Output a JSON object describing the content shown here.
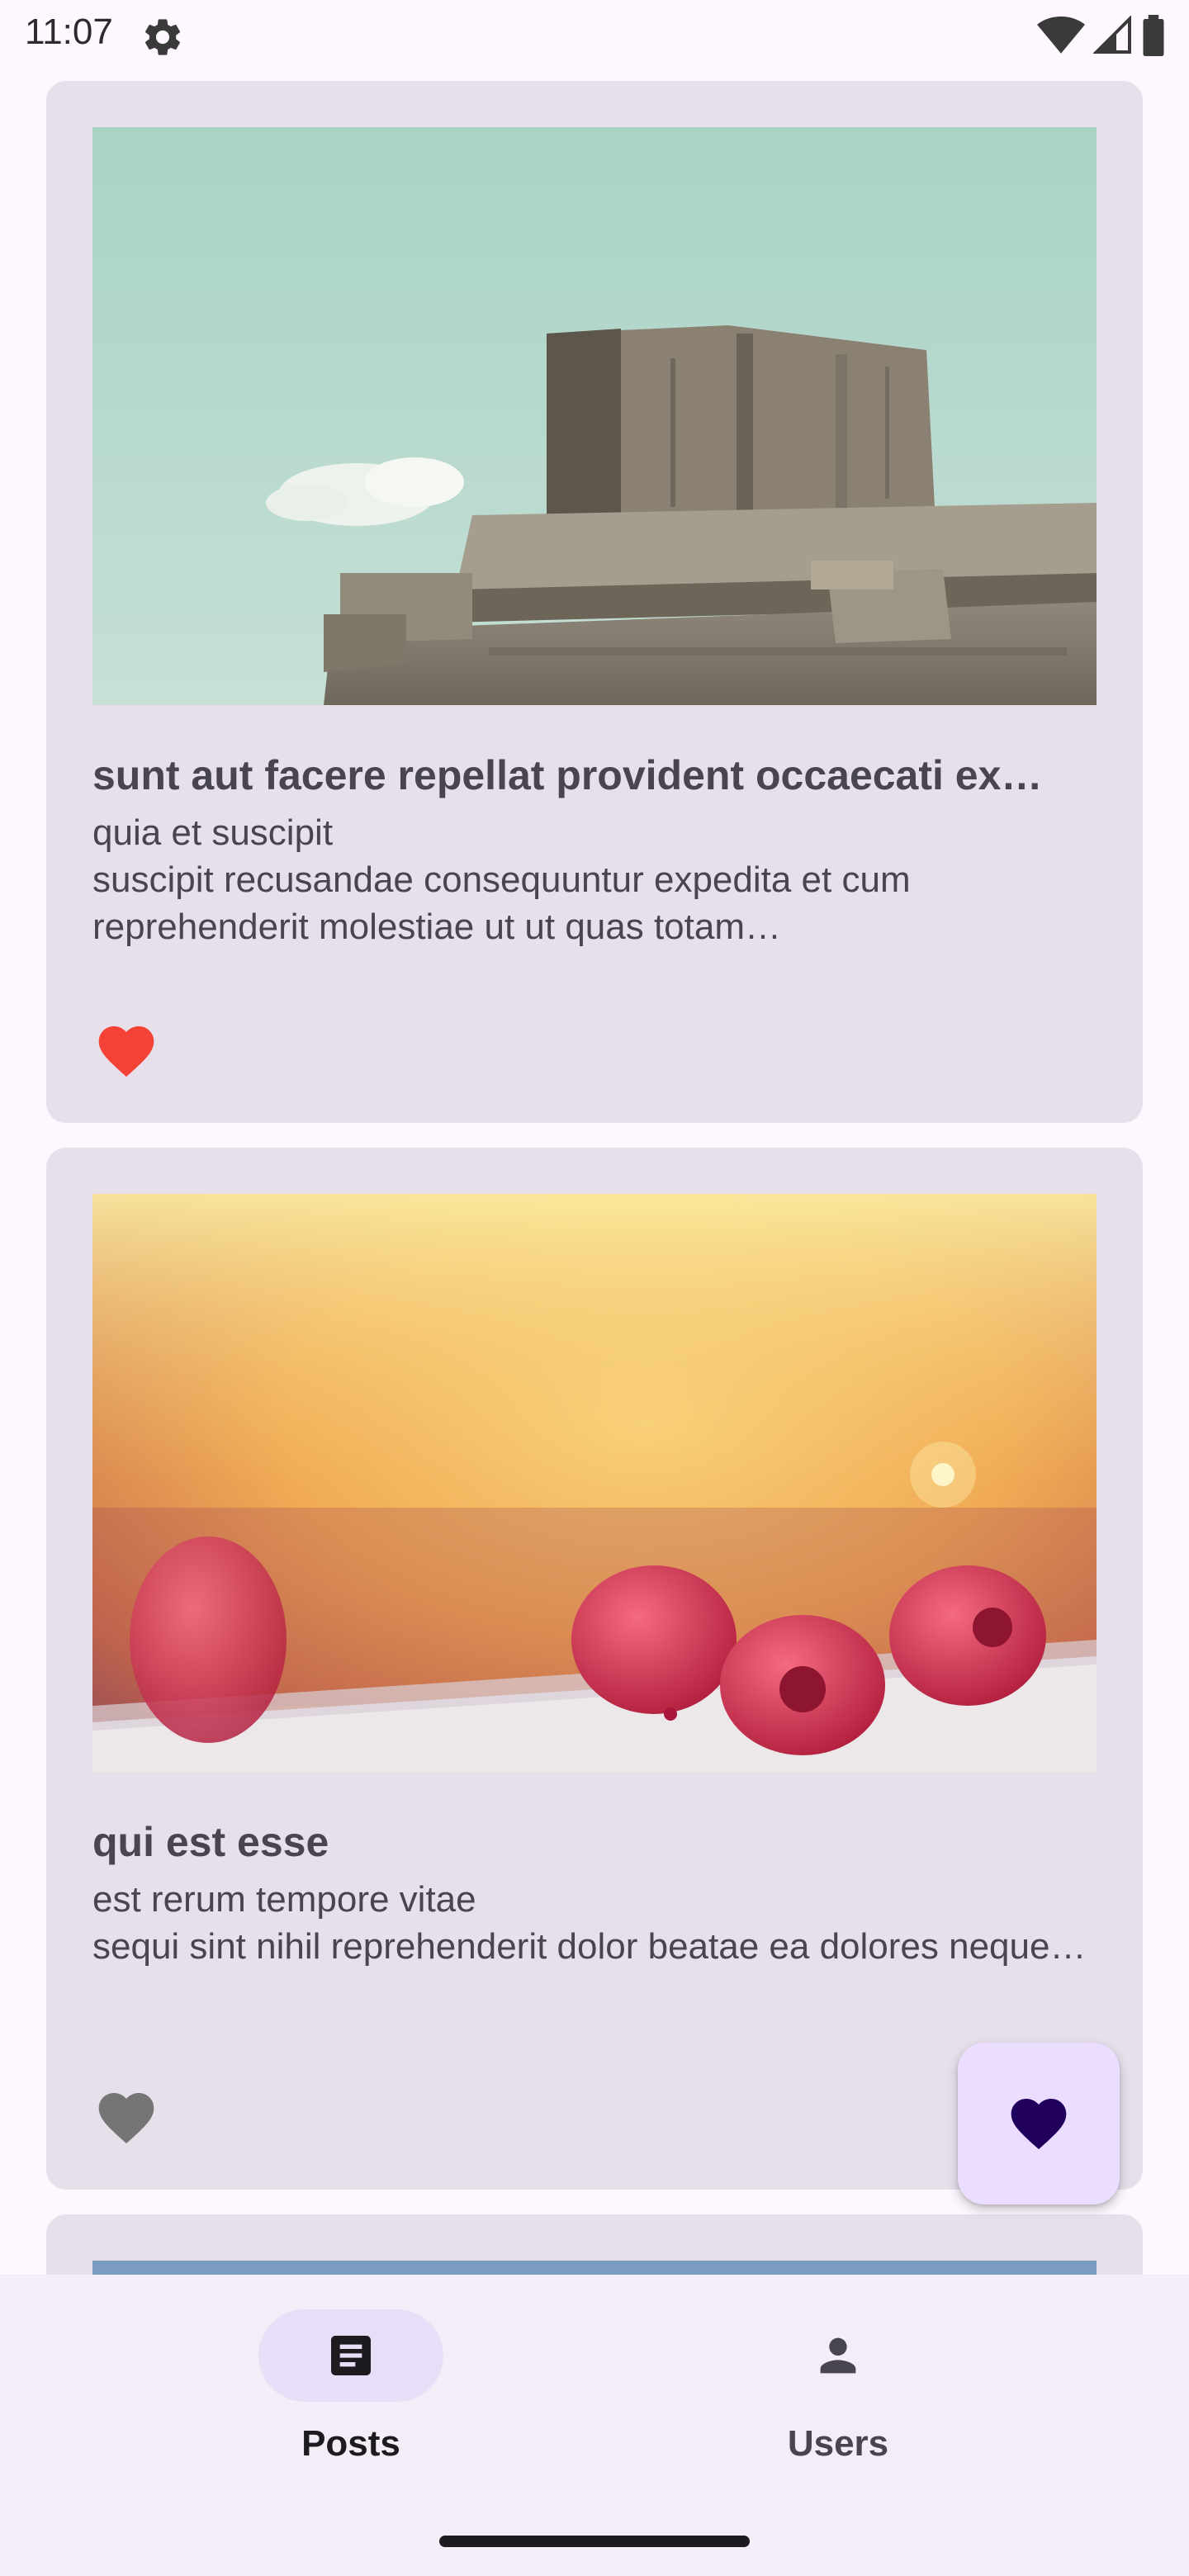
{
  "status_bar": {
    "time": "11:07",
    "icons": [
      "settings-gear-icon",
      "wifi-icon",
      "signal-icon",
      "battery-icon"
    ]
  },
  "posts": [
    {
      "title": "sunt aut facere repellat provident occaecati ex…",
      "body": "quia et suscipit\nsuscipit recusandae consequuntur expedita et cum reprehenderit molestiae ut ut quas totam…",
      "favorite": true,
      "image": "concrete-bunker-sky-photo"
    },
    {
      "title": "qui est esse",
      "body": "est rerum tempore vitae\nsequi sint nihil reprehenderit dolor beatae ea dolores neque…",
      "favorite": false,
      "image": "raspberries-warm-bokeh-photo"
    },
    {
      "image": "blue-image-partially-visible"
    }
  ],
  "fab": {
    "icon": "heart-icon"
  },
  "bottom_nav": {
    "items": [
      {
        "label": "Posts",
        "icon": "article-icon",
        "selected": true
      },
      {
        "label": "Users",
        "icon": "person-icon",
        "selected": false
      }
    ]
  },
  "colors": {
    "card_bg": "#e7e0eb",
    "favorite_red": "#f44336",
    "favorite_gray": "#757575",
    "fab_bg": "#eaddff",
    "fab_heart": "#21005d",
    "nav_bg": "#f2edf6",
    "nav_indicator": "#e8def8"
  }
}
